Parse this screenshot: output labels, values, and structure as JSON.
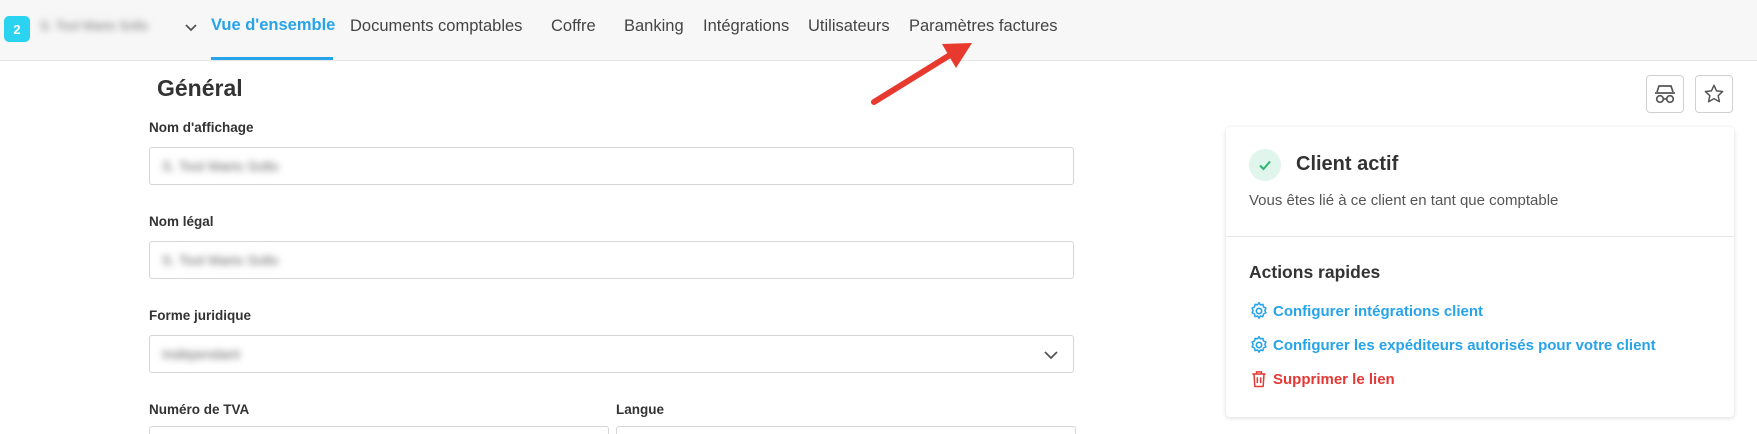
{
  "header": {
    "badge": "2",
    "client_name": "S. Tool Mario Sollo",
    "tabs": [
      {
        "label": "Vue d'ensemble",
        "active": true
      },
      {
        "label": "Documents comptables"
      },
      {
        "label": "Coffre"
      },
      {
        "label": "Banking"
      },
      {
        "label": "Intégrations"
      },
      {
        "label": "Utilisateurs"
      },
      {
        "label": "Paramètres factures"
      }
    ]
  },
  "form": {
    "section_title": "Général",
    "display_name": {
      "label": "Nom d'affichage",
      "value": "S. Tool Mario Sollo"
    },
    "legal_name": {
      "label": "Nom légal",
      "value": "S. Tool Mario Sollo"
    },
    "legal_form": {
      "label": "Forme juridique",
      "value": "Indépendant"
    },
    "vat": {
      "label": "Numéro de TVA"
    },
    "language": {
      "label": "Langue"
    }
  },
  "card": {
    "status_title": "Client actif",
    "status_subtitle": "Vous êtes lié à ce client en tant que comptable",
    "actions_title": "Actions rapides",
    "actions": [
      {
        "label": "Configurer intégrations client",
        "icon": "gear-icon"
      },
      {
        "label": "Configurer les expéditeurs autorisés pour votre client",
        "icon": "gear-icon"
      },
      {
        "label": "Supprimer le lien",
        "icon": "trash-icon"
      }
    ]
  },
  "colors": {
    "accent": "#27a3e8",
    "badge": "#2ad3f0",
    "danger": "#e53935",
    "success": "#2bb673",
    "arrow": "#e8392f"
  }
}
